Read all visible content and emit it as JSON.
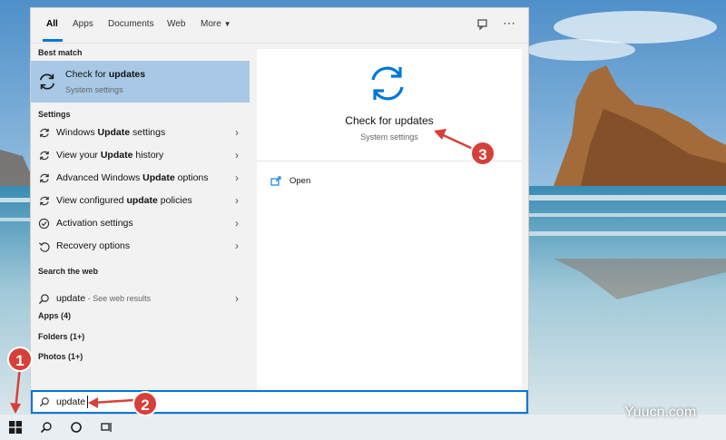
{
  "tabs": [
    "All",
    "Apps",
    "Documents",
    "Web",
    "More"
  ],
  "best_match": {
    "heading": "Best match",
    "title_prefix": "Check for ",
    "title_bold": "updates",
    "subtitle": "System settings"
  },
  "settings": {
    "heading": "Settings",
    "items": [
      {
        "before": "Windows ",
        "bold": "Update",
        "after": " settings",
        "icon": "sync-icon"
      },
      {
        "before": "View your ",
        "bold": "Update",
        "after": " history",
        "icon": "sync-icon"
      },
      {
        "before": "Advanced Windows ",
        "bold": "Update",
        "after": " options",
        "icon": "sync-icon"
      },
      {
        "before": "View configured ",
        "bold": "update",
        "after": " policies",
        "icon": "sync-icon"
      },
      {
        "before": "",
        "bold": "",
        "after": "Activation settings",
        "icon": "check-circle-icon"
      },
      {
        "before": "",
        "bold": "",
        "after": "Recovery options",
        "icon": "recovery-icon"
      }
    ]
  },
  "web": {
    "heading": "Search the web",
    "query": "update",
    "suffix": " - See web results"
  },
  "categories": [
    "Apps (4)",
    "Folders (1+)",
    "Photos (1+)"
  ],
  "preview": {
    "title": "Check for updates",
    "subtitle": "System settings",
    "action": "Open"
  },
  "search": {
    "value": "update"
  },
  "markers": [
    "1",
    "2",
    "3"
  ],
  "watermark": "Yuucn.com",
  "colors": {
    "accent": "#0078d7",
    "selected": "#a9c8e6",
    "marker": "#d6403a"
  }
}
